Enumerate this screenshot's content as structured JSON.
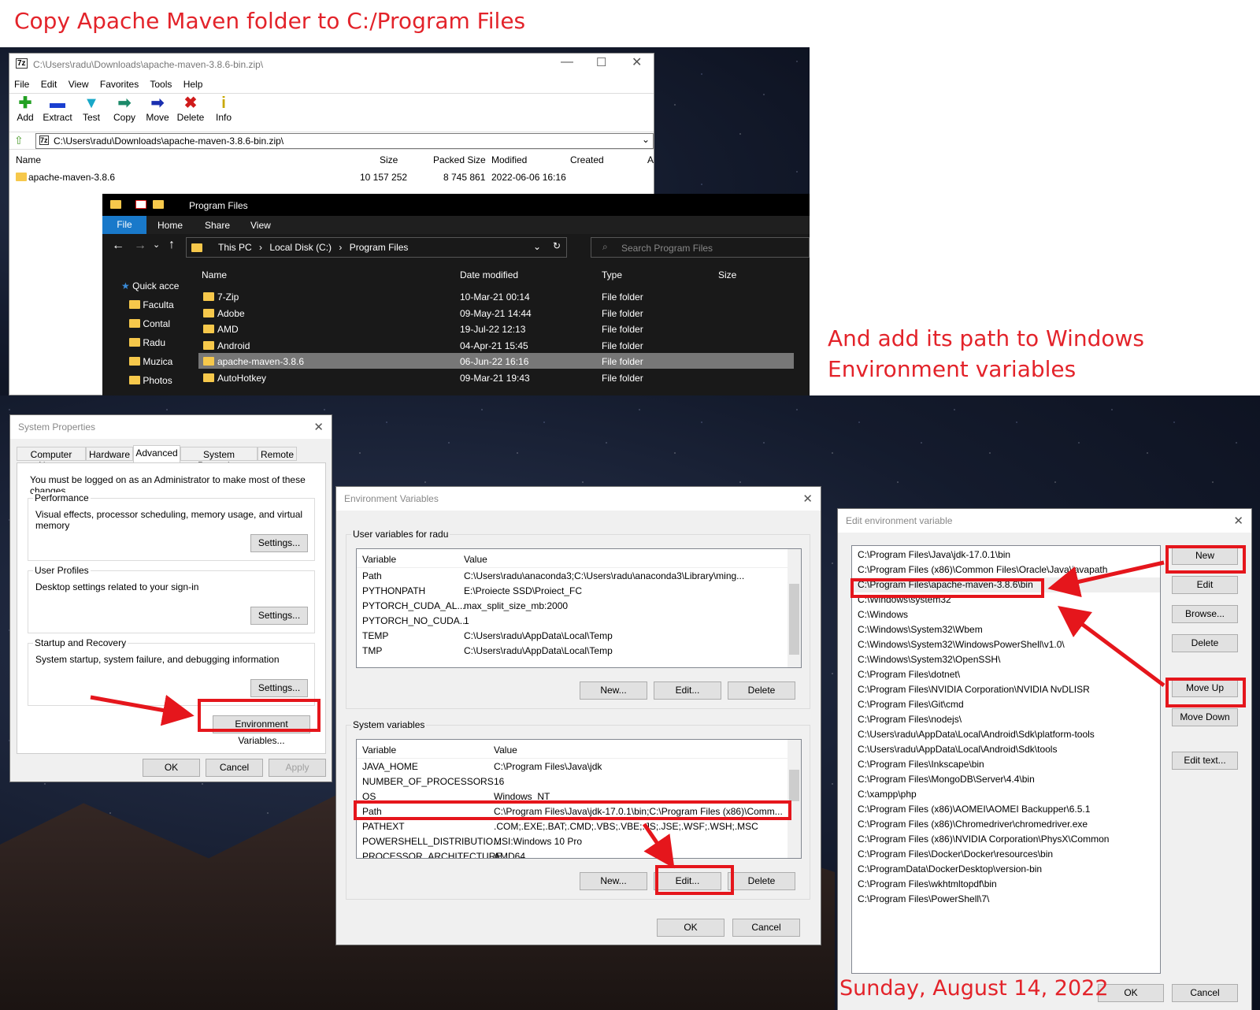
{
  "annotations": {
    "top_instruction": "Copy Apache Maven folder to C:/Program Files",
    "side_instruction_line1": "And add its path to Windows",
    "side_instruction_line2": "Environment variables",
    "date": "Sunday, August 14, 2022"
  },
  "zip_window": {
    "title": "C:\\Users\\radu\\Downloads\\apache-maven-3.8.6-bin.zip\\",
    "menu": [
      "File",
      "Edit",
      "View",
      "Favorites",
      "Tools",
      "Help"
    ],
    "tools": [
      "Add",
      "Extract",
      "Test",
      "Copy",
      "Move",
      "Delete",
      "Info"
    ],
    "path": "C:\\Users\\radu\\Downloads\\apache-maven-3.8.6-bin.zip\\",
    "columns": [
      "Name",
      "Size",
      "Packed Size",
      "Modified",
      "Created",
      "A"
    ],
    "row": {
      "name": "apache-maven-3.8.6",
      "size": "10 157 252",
      "packed": "8 745 861",
      "modified": "2022-06-06 16:16"
    }
  },
  "explorer": {
    "title": "Program Files",
    "ribbon_tabs": [
      "File",
      "Home",
      "Share",
      "View"
    ],
    "breadcrumb": [
      "This PC",
      "Local Disk (C:)",
      "Program Files"
    ],
    "search_placeholder": "Search Program Files",
    "columns": [
      "Name",
      "Date modified",
      "Type",
      "Size"
    ],
    "nav": [
      "Quick acce",
      "Faculta",
      "Contal",
      "Radu",
      "Muzica",
      "Photos"
    ],
    "rows": [
      {
        "name": "7-Zip",
        "date": "10-Mar-21 00:14",
        "type": "File folder"
      },
      {
        "name": "Adobe",
        "date": "09-May-21 14:44",
        "type": "File folder"
      },
      {
        "name": "AMD",
        "date": "19-Jul-22 12:13",
        "type": "File folder"
      },
      {
        "name": "Android",
        "date": "04-Apr-21 15:45",
        "type": "File folder"
      },
      {
        "name": "apache-maven-3.8.6",
        "date": "06-Jun-22 16:16",
        "type": "File folder"
      },
      {
        "name": "AutoHotkey",
        "date": "09-Mar-21 19:43",
        "type": "File folder"
      }
    ]
  },
  "sysprops": {
    "title": "System Properties",
    "tabs": [
      "Computer Name",
      "Hardware",
      "Advanced",
      "System Protection",
      "Remote"
    ],
    "admin_note": "You must be logged on as an Administrator to make most of these changes.",
    "performance": {
      "label": "Performance",
      "desc": "Visual effects, processor scheduling, memory usage, and virtual memory"
    },
    "profiles": {
      "label": "User Profiles",
      "desc": "Desktop settings related to your sign-in"
    },
    "startup": {
      "label": "Startup and Recovery",
      "desc": "System startup, system failure, and debugging information"
    },
    "settings_btn": "Settings...",
    "env_btn": "Environment Variables...",
    "ok": "OK",
    "cancel": "Cancel",
    "apply": "Apply"
  },
  "envvars": {
    "title": "Environment Variables",
    "user_label": "User variables for radu",
    "col_var": "Variable",
    "col_val": "Value",
    "user_rows": [
      {
        "v": "Path",
        "val": "C:\\Users\\radu\\anaconda3;C:\\Users\\radu\\anaconda3\\Library\\ming..."
      },
      {
        "v": "PYTHONPATH",
        "val": "E:\\Proiecte SSD\\Proiect_FC"
      },
      {
        "v": "PYTORCH_CUDA_AL...",
        "val": "max_split_size_mb:2000"
      },
      {
        "v": "PYTORCH_NO_CUDA...",
        "val": "1"
      },
      {
        "v": "TEMP",
        "val": "C:\\Users\\radu\\AppData\\Local\\Temp"
      },
      {
        "v": "TMP",
        "val": "C:\\Users\\radu\\AppData\\Local\\Temp"
      }
    ],
    "system_label": "System variables",
    "system_rows": [
      {
        "v": "JAVA_HOME",
        "val": "C:\\Program Files\\Java\\jdk"
      },
      {
        "v": "NUMBER_OF_PROCESSORS",
        "val": "16"
      },
      {
        "v": "OS",
        "val": "Windows_NT"
      },
      {
        "v": "Path",
        "val": "C:\\Program Files\\Java\\jdk-17.0.1\\bin;C:\\Program Files (x86)\\Comm..."
      },
      {
        "v": "PATHEXT",
        "val": ".COM;.EXE;.BAT;.CMD;.VBS;.VBE;.JS;.JSE;.WSF;.WSH;.MSC"
      },
      {
        "v": "POWERSHELL_DISTRIBUTIO...",
        "val": "MSI:Windows 10 Pro"
      },
      {
        "v": "PROCESSOR_ARCHITECTURE",
        "val": "AMD64"
      }
    ],
    "new_btn": "New...",
    "edit_btn": "Edit...",
    "delete_btn": "Delete",
    "ok": "OK",
    "cancel": "Cancel"
  },
  "editenv": {
    "title": "Edit environment variable",
    "entries": [
      "C:\\Program Files\\Java\\jdk-17.0.1\\bin",
      "C:\\Program Files (x86)\\Common Files\\Oracle\\Java\\javapath",
      "C:\\Program Files\\apache-maven-3.8.6\\bin",
      "C:\\Windows\\system32",
      "C:\\Windows",
      "C:\\Windows\\System32\\Wbem",
      "C:\\Windows\\System32\\WindowsPowerShell\\v1.0\\",
      "C:\\Windows\\System32\\OpenSSH\\",
      "C:\\Program Files\\dotnet\\",
      "C:\\Program Files\\NVIDIA Corporation\\NVIDIA NvDLISR",
      "C:\\Program Files\\Git\\cmd",
      "C:\\Program Files\\nodejs\\",
      "C:\\Users\\radu\\AppData\\Local\\Android\\Sdk\\platform-tools",
      "C:\\Users\\radu\\AppData\\Local\\Android\\Sdk\\tools",
      "C:\\Program Files\\Inkscape\\bin",
      "C:\\Program Files\\MongoDB\\Server\\4.4\\bin",
      "C:\\xampp\\php",
      "C:\\Program Files (x86)\\AOMEI\\AOMEI Backupper\\6.5.1",
      "C:\\Program Files (x86)\\Chromedriver\\chromedriver.exe",
      "C:\\Program Files (x86)\\NVIDIA Corporation\\PhysX\\Common",
      "C:\\Program Files\\Docker\\Docker\\resources\\bin",
      "C:\\ProgramData\\DockerDesktop\\version-bin",
      "C:\\Program Files\\wkhtmltopdf\\bin",
      "C:\\Program Files\\PowerShell\\7\\"
    ],
    "buttons": [
      "New",
      "Edit",
      "Browse...",
      "Delete",
      "Move Up",
      "Move Down",
      "Edit text..."
    ],
    "ok": "OK",
    "cancel": "Cancel"
  },
  "colors": {
    "annotation_red": "#e3232a",
    "selection_gray": "#777777",
    "explorer_bg": "#191919"
  }
}
